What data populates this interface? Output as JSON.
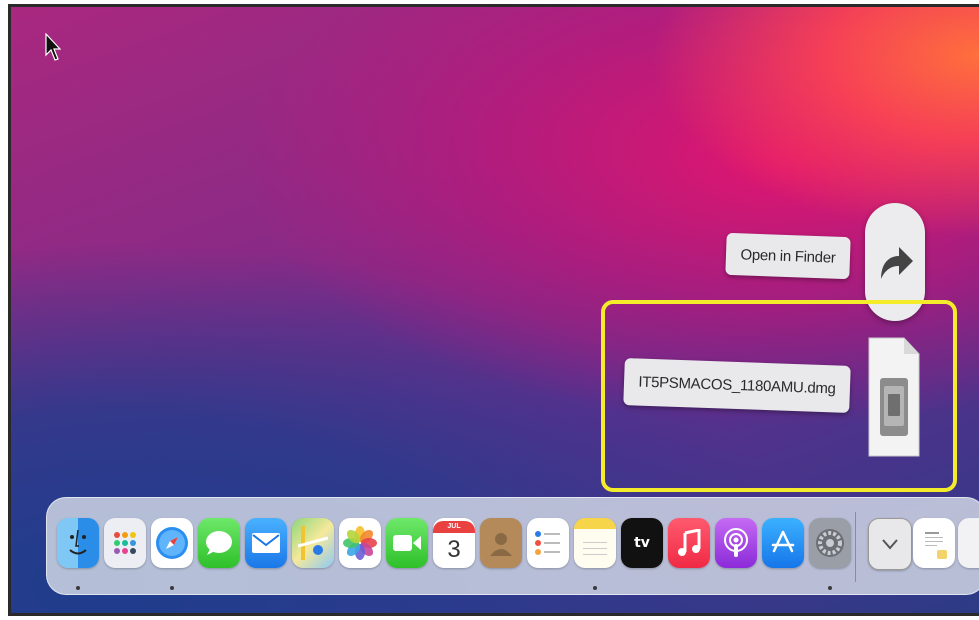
{
  "popup": {
    "open_in_finder_label": "Open in Finder",
    "file_name": "IT5PSMACOS_1180AMU.dmg"
  },
  "dock": {
    "calendar_month": "JUL",
    "calendar_day": "3",
    "apps": [
      {
        "name": "Finder",
        "icon": "finder-icon",
        "running": true
      },
      {
        "name": "Launchpad",
        "icon": "launchpad-icon",
        "running": false
      },
      {
        "name": "Safari",
        "icon": "safari-icon",
        "running": true
      },
      {
        "name": "Messages",
        "icon": "messages-icon",
        "running": false
      },
      {
        "name": "Mail",
        "icon": "mail-icon",
        "running": false
      },
      {
        "name": "Maps",
        "icon": "maps-icon",
        "running": false
      },
      {
        "name": "Photos",
        "icon": "photos-icon",
        "running": false
      },
      {
        "name": "FaceTime",
        "icon": "facetime-icon",
        "running": false
      },
      {
        "name": "Calendar",
        "icon": "calendar-icon",
        "running": false
      },
      {
        "name": "Contacts",
        "icon": "contacts-icon",
        "running": false
      },
      {
        "name": "Reminders",
        "icon": "reminders-icon",
        "running": false
      },
      {
        "name": "Notes",
        "icon": "notes-icon",
        "running": true
      },
      {
        "name": "TV",
        "icon": "apple-tv-icon",
        "running": false
      },
      {
        "name": "Music",
        "icon": "music-icon",
        "running": false
      },
      {
        "name": "Podcasts",
        "icon": "podcasts-icon",
        "running": false
      },
      {
        "name": "App Store",
        "icon": "app-store-icon",
        "running": false
      },
      {
        "name": "System Preferences",
        "icon": "system-preferences-icon",
        "running": true
      }
    ],
    "tv_label": "tv"
  },
  "colors": {
    "highlight": "#f4ec2a"
  }
}
